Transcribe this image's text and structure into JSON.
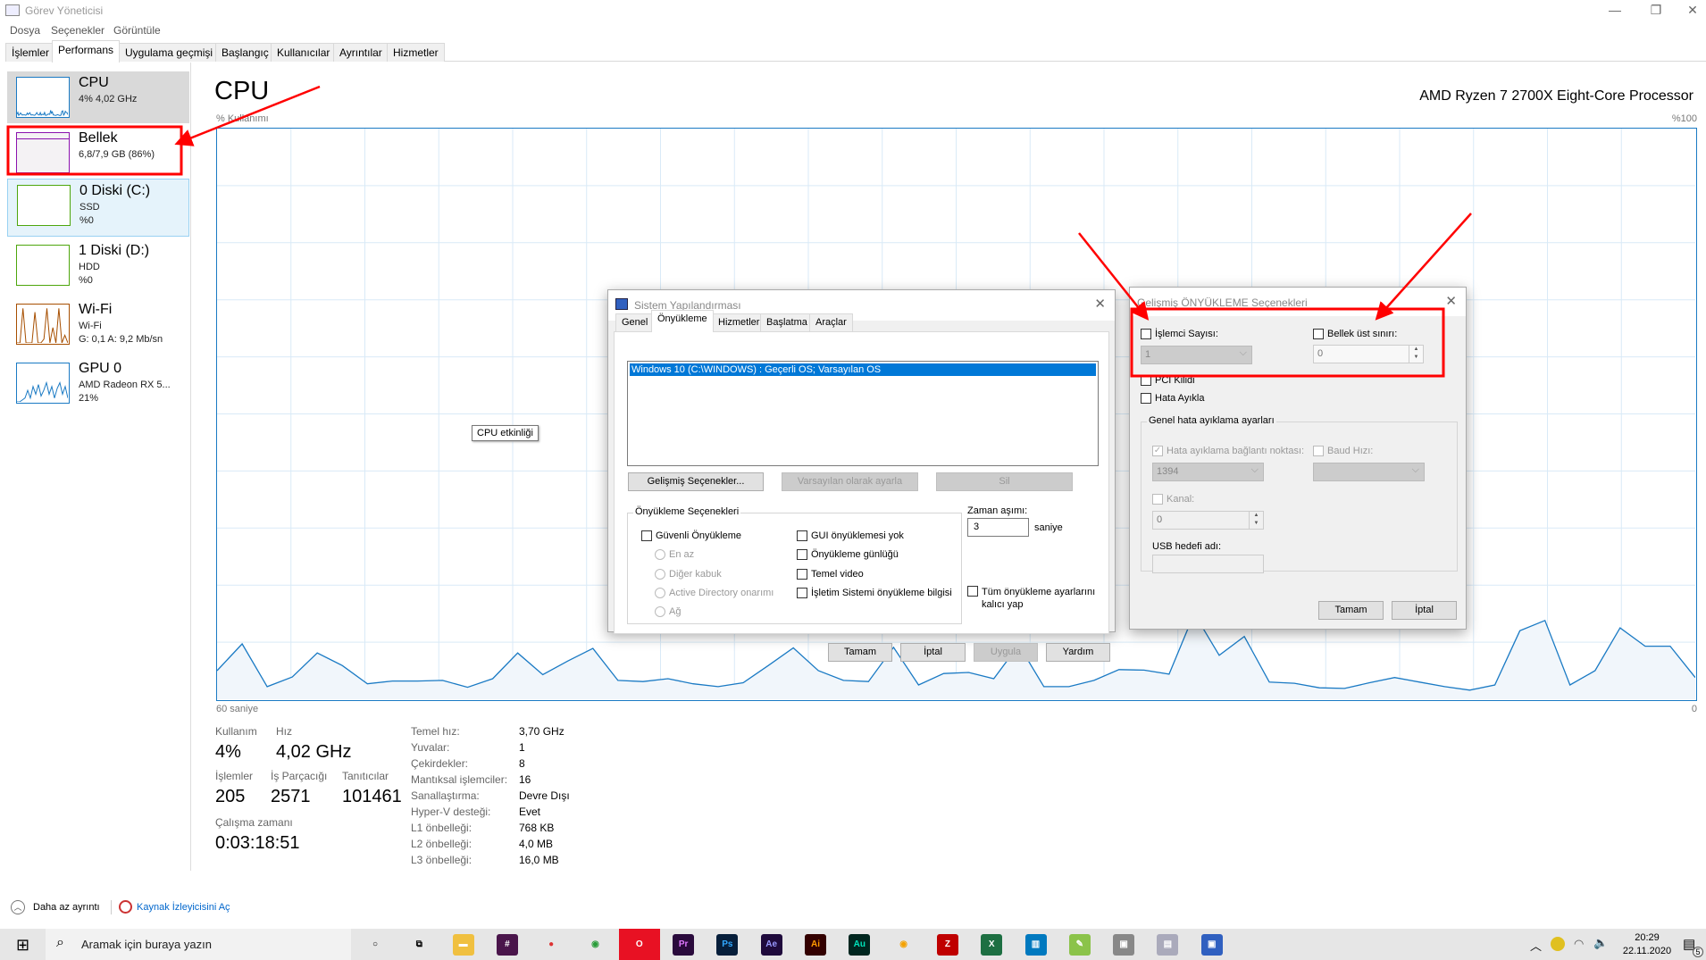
{
  "window": {
    "title": "Görev Yöneticisi",
    "minimize": "—",
    "restore": "❐",
    "close": "✕"
  },
  "menu": [
    "Dosya",
    "Seçenekler",
    "Görüntüle"
  ],
  "tabs": [
    "İşlemler",
    "Performans",
    "Uygulama geçmişi",
    "Başlangıç",
    "Kullanıcılar",
    "Ayrıntılar",
    "Hizmetler"
  ],
  "sidebar": [
    {
      "name": "CPU",
      "line1": "4% 4,02 GHz",
      "line2": "",
      "color": "#1a7ac4"
    },
    {
      "name": "Bellek",
      "line1": "6,8/7,9 GB (86%)",
      "line2": "",
      "color": "#8b12ae"
    },
    {
      "name": "0 Diski (C:)",
      "line1": "SSD",
      "line2": "%0",
      "color": "#4da60c"
    },
    {
      "name": "1 Diski (D:)",
      "line1": "HDD",
      "line2": "%0",
      "color": "#4da60c"
    },
    {
      "name": "Wi-Fi",
      "line1": "Wi-Fi",
      "line2": "G: 0,1 A: 9,2 Mb/sn",
      "color": "#a74f01"
    },
    {
      "name": "GPU 0",
      "line1": "AMD Radeon RX 5...",
      "line2": "21%",
      "color": "#1a7ac4"
    }
  ],
  "main": {
    "title": "CPU",
    "processor": "AMD Ryzen 7 2700X Eight-Core Processor",
    "y_label": "% Kullanımı",
    "y_max": "%100",
    "x_left": "60 saniye",
    "x_right": "0",
    "tooltip": "CPU etkinliği",
    "graph": {
      "unit": "percent",
      "max": 100,
      "values": [
        5,
        9.7,
        2.2,
        3.9,
        8.1,
        5.9,
        2.7,
        3.2,
        3.2,
        3.3,
        2.1,
        3.6,
        8.1,
        4.3,
        6.7,
        8.9,
        3.3,
        3.1,
        3.6,
        2.7,
        2.2,
        2.9,
        5.9,
        9,
        5,
        3.3,
        3.1,
        9.1,
        2.5,
        4.5,
        4.7,
        3.6,
        9.5,
        2.2,
        2.2,
        3.3,
        5.2,
        5.1,
        4.4,
        15,
        7.7,
        11,
        3,
        2.8,
        2,
        1.9,
        2.9,
        3.8,
        3,
        2.2,
        1.6,
        2.5,
        12,
        13.8,
        2.5,
        5,
        12.5,
        9.3,
        9.3,
        3.8
      ]
    },
    "stats": {
      "usage_label": "Kullanım",
      "usage": "4%",
      "speed_label": "Hız",
      "speed": "4,02 GHz",
      "proc_label": "İşlemler",
      "proc": "205",
      "threads_label": "İş Parçacığı",
      "threads": "2571",
      "handles_label": "Tanıtıcılar",
      "handles": "101461",
      "uptime_label": "Çalışma zamanı",
      "uptime": "0:03:18:51"
    },
    "details": [
      {
        "k": "Temel hız:",
        "v": "3,70 GHz"
      },
      {
        "k": "Yuvalar:",
        "v": "1"
      },
      {
        "k": "Çekirdekler:",
        "v": "8"
      },
      {
        "k": "Mantıksal işlemciler:",
        "v": "16"
      },
      {
        "k": "Sanallaştırma:",
        "v": "Devre Dışı"
      },
      {
        "k": "Hyper-V desteği:",
        "v": "Evet"
      },
      {
        "k": "L1 önbelleği:",
        "v": "768 KB"
      },
      {
        "k": "L2 önbelleği:",
        "v": "4,0 MB"
      },
      {
        "k": "L3 önbelleği:",
        "v": "16,0 MB"
      }
    ]
  },
  "footer": {
    "less": "Daha az ayrıntı",
    "monitor": "Kaynak İzleyicisini Aç"
  },
  "msconfig": {
    "title": "Sistem Yapılandırması",
    "tabs": [
      "Genel",
      "Önyükleme",
      "Hizmetler",
      "Başlatma",
      "Araçlar"
    ],
    "os_entry": "Windows 10 (C:\\WINDOWS) : Geçerli OS; Varsayılan OS",
    "advanced_btn": "Gelişmiş Seçenekler...",
    "default_btn": "Varsayılan olarak ayarla",
    "delete_btn": "Sil",
    "group": "Önyükleme Seçenekleri",
    "safe": "Güvenli Önyükleme",
    "radios": [
      "En az",
      "Diğer kabuk",
      "Active Directory onarımı",
      "Ağ"
    ],
    "checks": [
      "GUI önyüklemesi yok",
      "Önyükleme günlüğü",
      "Temel video",
      "İşletim Sistemi önyükleme bilgisi"
    ],
    "timeout_label": "Zaman aşımı:",
    "timeout": "3",
    "seconds": "saniye",
    "permanent": "Tüm önyükleme ayarlarını kalıcı yap",
    "ok": "Tamam",
    "cancel": "İptal",
    "apply": "Uygula",
    "help": "Yardım"
  },
  "advanced": {
    "title": "Gelişmiş ÖNYÜKLEME Seçenekleri",
    "cpu_count": "İşlemci Sayısı:",
    "cpu_value": "1",
    "max_mem": "Bellek üst sınırı:",
    "mem_value": "0",
    "pci": "PCI Kilidi",
    "debug": "Hata Ayıkla",
    "group": "Genel hata ayıklama ayarları",
    "debug_port": "Hata ayıklama bağlantı noktası:",
    "port_value": "1394",
    "baud": "Baud Hızı:",
    "channel": "Kanal:",
    "channel_value": "0",
    "usb": "USB hedefi adı:",
    "ok": "Tamam",
    "cancel": "İptal"
  },
  "taskbar": {
    "search_placeholder": "Aramak için buraya yazın",
    "time": "20:29",
    "date": "22.11.2020",
    "notifications": "5",
    "apps": [
      {
        "icon": "cortana-icon",
        "label": "○",
        "bg": "transparent",
        "fg": "#000"
      },
      {
        "icon": "task-view-icon",
        "label": "⧉",
        "bg": "transparent",
        "fg": "#000"
      },
      {
        "icon": "file-explorer-icon",
        "label": "▬",
        "bg": "#f0c040",
        "fg": "#fff"
      },
      {
        "icon": "slack-icon",
        "label": "#",
        "bg": "#4a154b",
        "fg": "#fff"
      },
      {
        "icon": "app-red-icon",
        "label": "●",
        "bg": "transparent",
        "fg": "#d33"
      },
      {
        "icon": "chrome-icon",
        "label": "◉",
        "bg": "transparent",
        "fg": "#2a9d3a"
      },
      {
        "icon": "opera-icon",
        "label": "O",
        "bg": "#e81123",
        "fg": "#fff"
      },
      {
        "icon": "premiere-icon",
        "label": "Pr",
        "bg": "#2a0a3c",
        "fg": "#e077ff"
      },
      {
        "icon": "photoshop-icon",
        "label": "Ps",
        "bg": "#061e3a",
        "fg": "#31a8ff"
      },
      {
        "icon": "after-effects-icon",
        "label": "Ae",
        "bg": "#1f0a3c",
        "fg": "#9999ff"
      },
      {
        "icon": "illustrator-icon",
        "label": "Ai",
        "bg": "#330000",
        "fg": "#ff9a00"
      },
      {
        "icon": "audition-icon",
        "label": "Au",
        "bg": "#00261f",
        "fg": "#00e4bb"
      },
      {
        "icon": "chrome-canary-icon",
        "label": "◉",
        "bg": "transparent",
        "fg": "#f4a100"
      },
      {
        "icon": "filezilla-icon",
        "label": "Z",
        "bg": "#bf0000",
        "fg": "#fff"
      },
      {
        "icon": "excel-icon",
        "label": "X",
        "bg": "#1d6f42",
        "fg": "#fff"
      },
      {
        "icon": "trello-icon",
        "label": "▥",
        "bg": "#0079bf",
        "fg": "#fff"
      },
      {
        "icon": "notepad-icon",
        "label": "✎",
        "bg": "#8bc34a",
        "fg": "#fff"
      },
      {
        "icon": "device-icon",
        "label": "▣",
        "bg": "#888",
        "fg": "#fff"
      },
      {
        "icon": "app-gray-icon",
        "label": "▤",
        "bg": "#aab",
        "fg": "#fff"
      },
      {
        "icon": "msconfig-icon",
        "label": "▣",
        "bg": "#3060c0",
        "fg": "#fff"
      }
    ]
  },
  "colors": {
    "accent": "#1a7ac4",
    "annotation": "#ff0000",
    "selection": "#0078d7"
  }
}
